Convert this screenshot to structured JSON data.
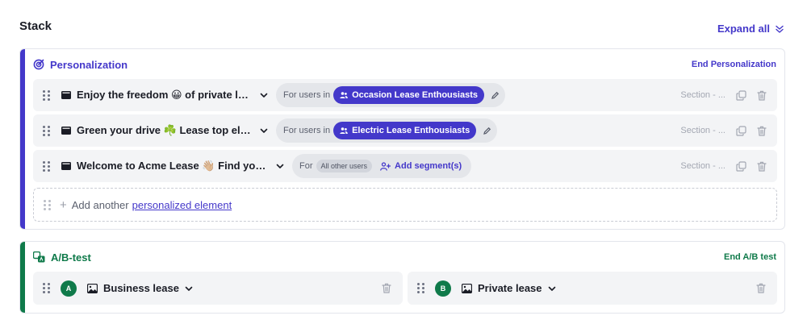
{
  "stack": {
    "title": "Stack",
    "expand_label": "Expand all"
  },
  "personalization": {
    "title": "Personalization",
    "end_label": "End Personalization",
    "rows": [
      {
        "title": "Enjoy the freedom 😀 of private leas...",
        "for_label": "For users in",
        "segment": "Occasion Lease Enthousiasts",
        "section": "Section - ..."
      },
      {
        "title": "Green your drive ☘️ Lease top electri...",
        "for_label": "For users in",
        "segment": "Electric Lease Enthousiasts",
        "section": "Section - ..."
      },
      {
        "title": "Welcome to Acme Lease 👋🏼 Find your car",
        "for_label": "For",
        "segment": "All other users",
        "add_segment": "Add segment(s)",
        "section": "Section - ..."
      }
    ],
    "add_another": {
      "text": "Add another",
      "link": "personalized element"
    }
  },
  "ab_test": {
    "title": "A/B-test",
    "end_label": "End A/B test",
    "variants": [
      {
        "badge": "A",
        "title": "Business lease"
      },
      {
        "badge": "B",
        "title": "Private lease"
      }
    ]
  },
  "colors": {
    "personal_accent": "#4338ca",
    "ab_accent": "#0f7a4a"
  }
}
